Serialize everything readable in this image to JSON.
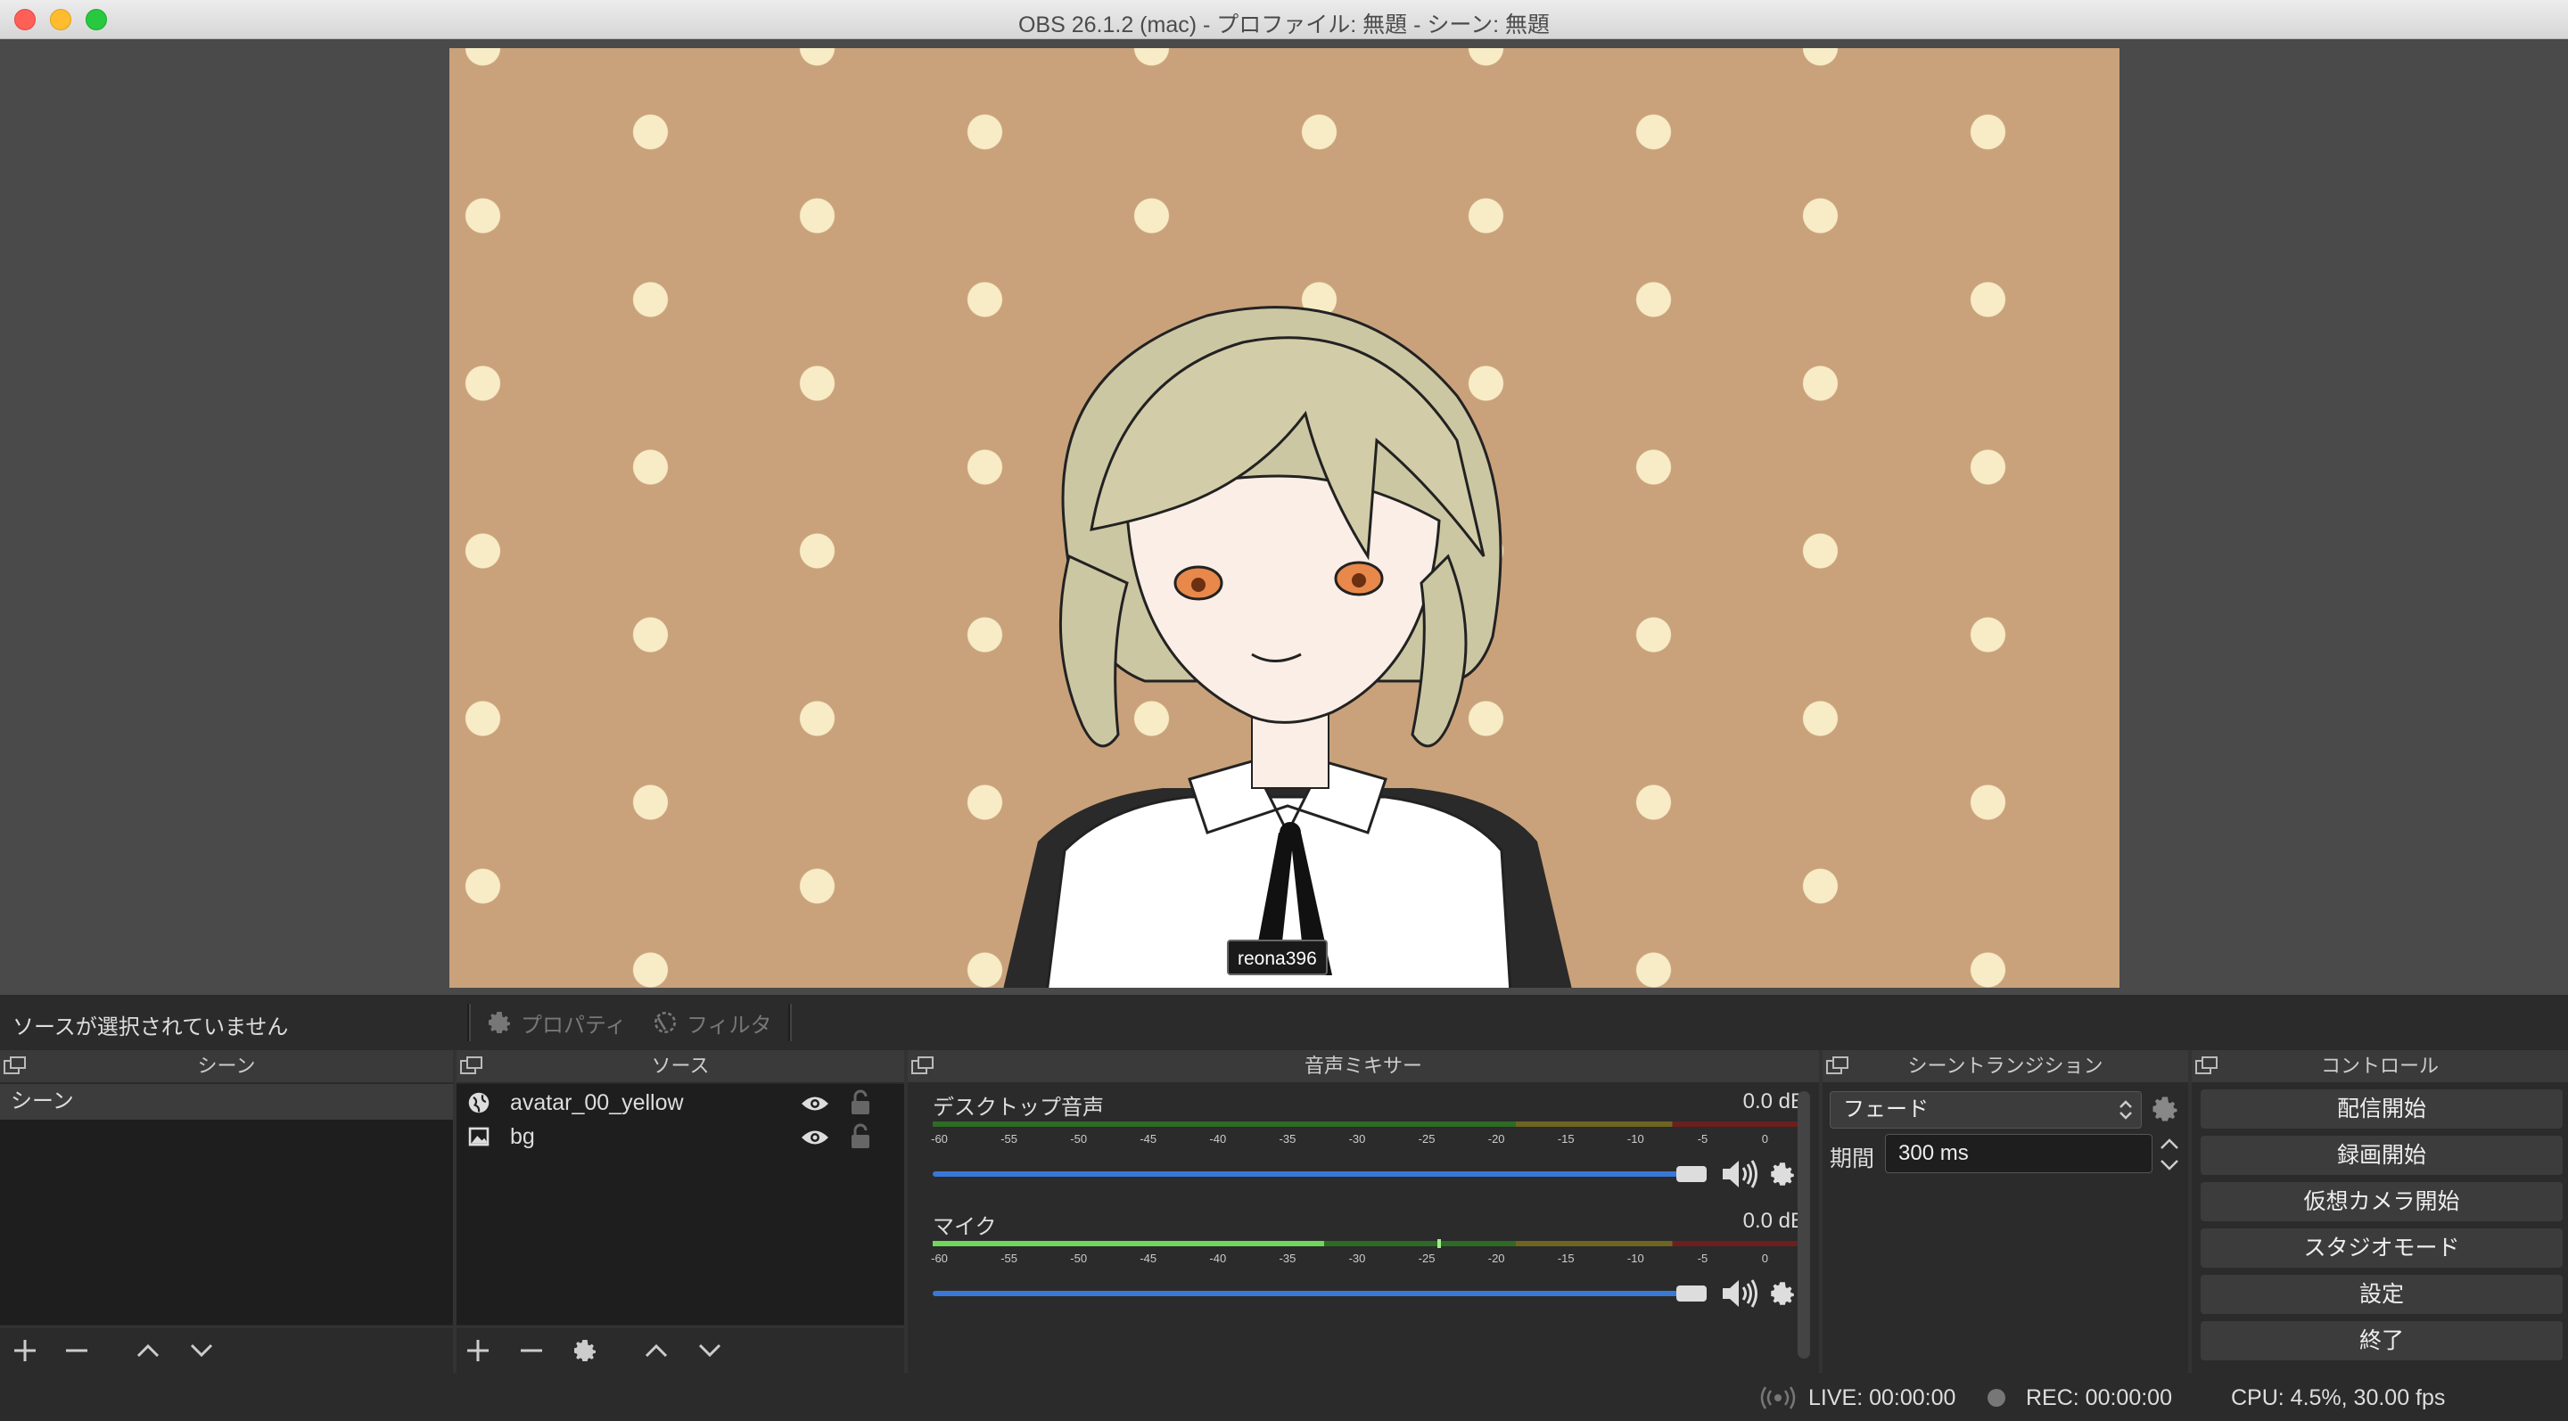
{
  "window": {
    "title": "OBS 26.1.2 (mac) - プロファイル: 無題 - シーン: 無題"
  },
  "preview": {
    "name_tag": "reona396"
  },
  "source_bar": {
    "status": "ソースが選択されていません",
    "properties_label": "プロパティ",
    "filters_label": "フィルタ"
  },
  "scenes": {
    "header": "シーン",
    "items": [
      {
        "label": "シーン"
      }
    ]
  },
  "sources": {
    "header": "ソース",
    "items": [
      {
        "label": "avatar_00_yellow",
        "icon": "browser-globe-icon"
      },
      {
        "label": "bg",
        "icon": "image-icon"
      }
    ]
  },
  "mixer": {
    "header": "音声ミキサー",
    "scale": [
      "-60",
      "-55",
      "-50",
      "-45",
      "-40",
      "-35",
      "-30",
      "-25",
      "-20",
      "-15",
      "-10",
      "-5",
      "0"
    ],
    "channels": [
      {
        "name": "デスクトップ音声",
        "db": "0.0 dB",
        "level_fraction": 0.0,
        "volume_fraction": 1.0
      },
      {
        "name": "マイク",
        "db": "0.0 dB",
        "level_fraction": 0.45,
        "volume_fraction": 1.0
      }
    ]
  },
  "transition": {
    "header": "シーントランジション",
    "type": "フェード",
    "duration_label": "期間",
    "duration_value": "300 ms"
  },
  "controls": {
    "header": "コントロール",
    "buttons": [
      {
        "label": "配信開始",
        "name": "start-streaming-button"
      },
      {
        "label": "録画開始",
        "name": "start-recording-button"
      },
      {
        "label": "仮想カメラ開始",
        "name": "start-virtual-camera-button"
      },
      {
        "label": "スタジオモード",
        "name": "studio-mode-button"
      },
      {
        "label": "設定",
        "name": "settings-button"
      },
      {
        "label": "終了",
        "name": "exit-button"
      }
    ]
  },
  "status": {
    "live": "LIVE: 00:00:00",
    "rec": "REC: 00:00:00",
    "cpu": "CPU: 4.5%, 30.00 fps"
  },
  "colors": {
    "accent": "#3a78d8",
    "meter_green": "#4caf3f",
    "meter_yellow": "#a69a2a",
    "meter_red": "#9c2a2a",
    "canvas_bg": "#c9a27b",
    "dot": "#f8ecc6"
  }
}
